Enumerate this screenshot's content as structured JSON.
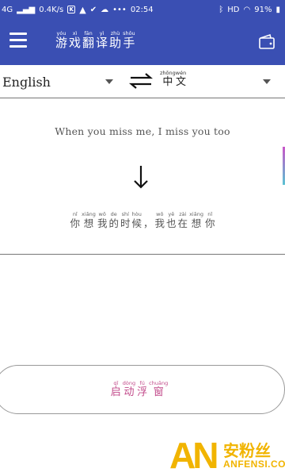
{
  "status_bar": {
    "network": "4G",
    "speed": "0.4K/s",
    "k_icon_text": "K",
    "dots": "•••",
    "time": "02:54",
    "hd": "HD",
    "battery": "91%"
  },
  "app_bar": {
    "title": [
      {
        "py": "yóu",
        "hz": "游"
      },
      {
        "py": "xì",
        "hz": "戏"
      },
      {
        "py": "fān",
        "hz": "翻"
      },
      {
        "py": "yì",
        "hz": "译"
      },
      {
        "py": "zhù",
        "hz": "助"
      },
      {
        "py": "shǒu",
        "hz": "手"
      }
    ],
    "menu_icon": "hamburger-menu-icon",
    "right_icon": "wallet-icon"
  },
  "language": {
    "source": "English",
    "target": [
      {
        "py": "zhōng",
        "hz": "中"
      },
      {
        "py": "wén",
        "hz": "文"
      }
    ],
    "swap_icon": "swap-arrows-icon"
  },
  "translation": {
    "source_text": "When you miss me, I miss you too",
    "result": [
      {
        "py": "nǐ",
        "hz": "你"
      },
      {
        "py": "xiǎng",
        "hz": "想"
      },
      {
        "py": "wǒ",
        "hz": "我"
      },
      {
        "py": "de",
        "hz": "的"
      },
      {
        "py": "shí",
        "hz": "时"
      },
      {
        "py": "hòu",
        "hz": "候"
      },
      {
        "py": "",
        "hz": "，"
      },
      {
        "py": "wǒ",
        "hz": "我"
      },
      {
        "py": "yě",
        "hz": "也"
      },
      {
        "py": "zài",
        "hz": "在"
      },
      {
        "py": "xiǎng",
        "hz": "想"
      },
      {
        "py": "nǐ",
        "hz": "你"
      }
    ]
  },
  "float_button": [
    {
      "py": "qǐ",
      "hz": "启"
    },
    {
      "py": "dòng",
      "hz": "动"
    },
    {
      "py": "fú",
      "hz": "浮"
    },
    {
      "py": "chuāng",
      "hz": "窗"
    }
  ],
  "watermark": {
    "logo": "AN",
    "cn": "安粉丝",
    "en": "ANFENSI.COM"
  },
  "colors": {
    "app_bar": "#3a4fb3",
    "button_text": "#c24a8a",
    "watermark": "#f1b400"
  }
}
